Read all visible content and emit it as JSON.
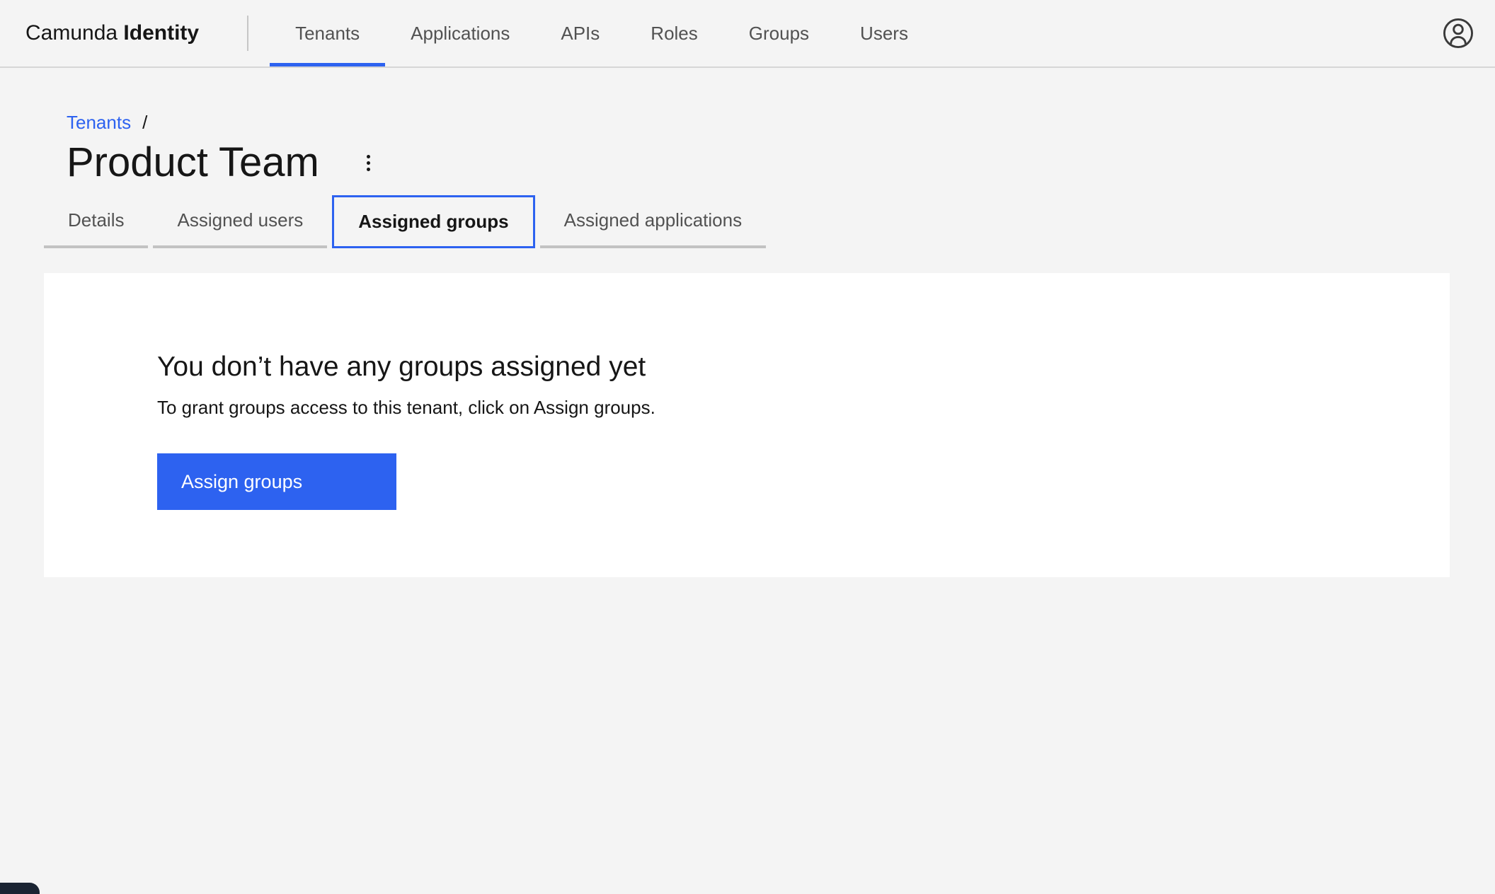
{
  "header": {
    "brand": {
      "name": "Camunda",
      "product": "Identity"
    },
    "nav": [
      {
        "label": "Tenants",
        "active": true
      },
      {
        "label": "Applications",
        "active": false
      },
      {
        "label": "APIs",
        "active": false
      },
      {
        "label": "Roles",
        "active": false
      },
      {
        "label": "Groups",
        "active": false
      },
      {
        "label": "Users",
        "active": false
      }
    ],
    "avatar_icon": "user-avatar-icon"
  },
  "breadcrumb": {
    "link": "Tenants",
    "separator": "/"
  },
  "page": {
    "title": "Product Team",
    "overflow_menu_icon": "kebab-vertical-icon"
  },
  "tabs": [
    {
      "label": "Details",
      "active": false
    },
    {
      "label": "Assigned users",
      "active": false
    },
    {
      "label": "Assigned groups",
      "active": true
    },
    {
      "label": "Assigned applications",
      "active": false
    }
  ],
  "empty_state": {
    "heading": "You don’t have any groups assigned yet",
    "description": "To grant groups access to this tenant, click on Assign groups.",
    "action_label": "Assign groups"
  },
  "colors": {
    "accent_blue": "#2d62f0",
    "text_primary": "#161616",
    "text_secondary": "#525252",
    "page_bg": "#f4f4f4",
    "card_bg": "#ffffff",
    "tab_underline_gray": "#c2c2c2",
    "corner_widget_navy": "#1b2433"
  }
}
